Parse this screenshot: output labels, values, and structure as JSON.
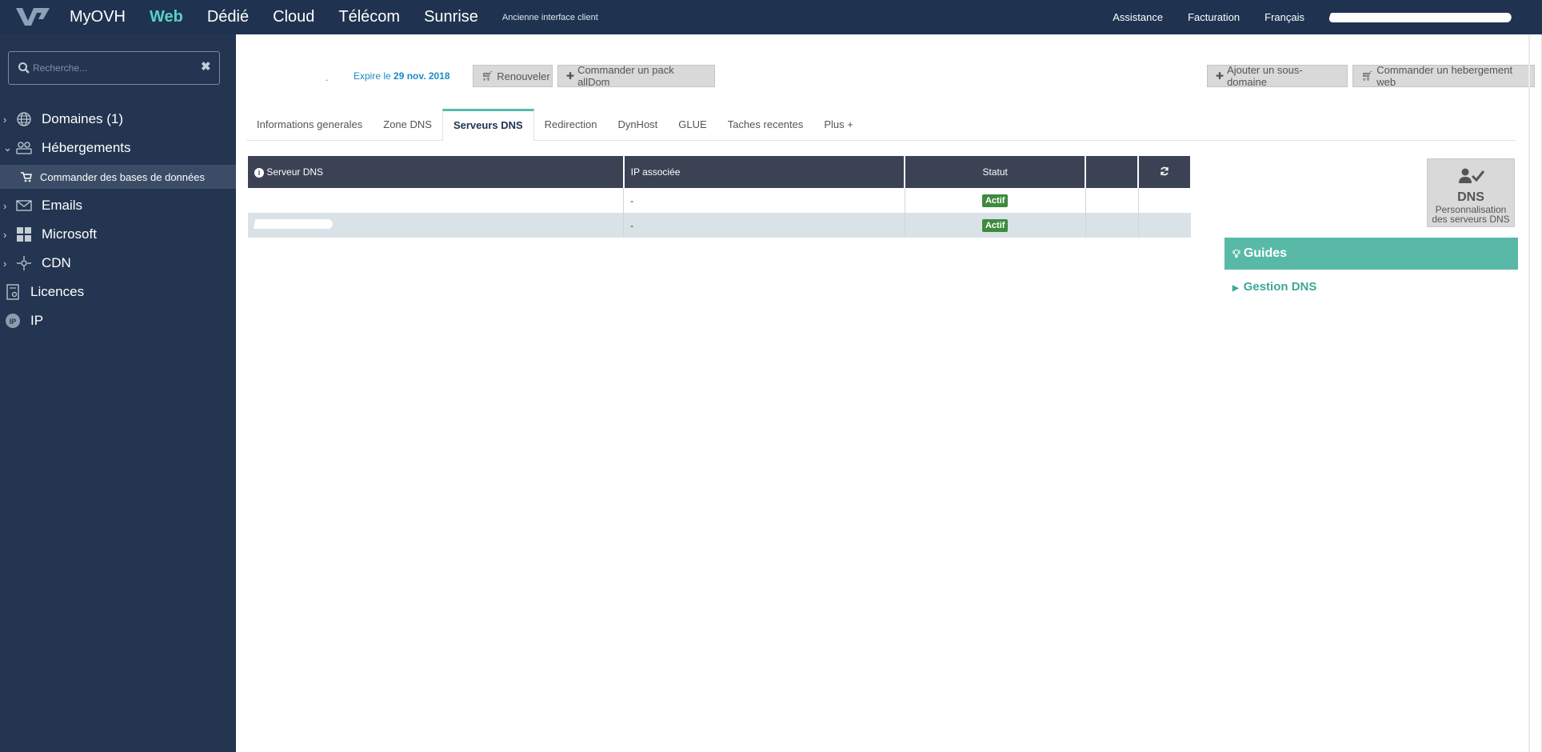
{
  "topbar": {
    "nav": [
      "MyOVH",
      "Web",
      "Dédié",
      "Cloud",
      "Télécom",
      "Sunrise"
    ],
    "active_index": 1,
    "old_interface": "Ancienne interface client",
    "right": [
      "Assistance",
      "Facturation",
      "Français"
    ]
  },
  "sidebar": {
    "search_placeholder": "Recherche...",
    "items": [
      {
        "label": "Domaines (1)",
        "icon": "globe-icon"
      },
      {
        "label": "Hébergements",
        "icon": "hosting-icon"
      },
      {
        "label": "Emails",
        "icon": "envelope-icon"
      },
      {
        "label": "Microsoft",
        "icon": "windows-icon"
      },
      {
        "label": "CDN",
        "icon": "cdn-icon"
      },
      {
        "label": "Licences",
        "icon": "license-icon"
      },
      {
        "label": "IP",
        "icon": "ip-icon"
      }
    ],
    "subitem": "Commander des bases de données"
  },
  "header": {
    "dot": ".",
    "expire_prefix": "Expire le",
    "expire_date": "29 nov. 2018",
    "renew": "Renouveler",
    "order_pack": "Commander un pack allDom",
    "add_subdomain": "Ajouter un sous-domaine",
    "order_hosting": "Commander un hebergement web"
  },
  "tabs": [
    "Informations generales",
    "Zone DNS",
    "Serveurs DNS",
    "Redirection",
    "DynHost",
    "GLUE",
    "Taches recentes",
    "Plus +"
  ],
  "active_tab": 2,
  "table": {
    "headers": [
      "Serveur DNS",
      "IP associée",
      "Statut"
    ],
    "rows": [
      {
        "ip": "-",
        "status": "Actif"
      },
      {
        "ip": "-",
        "status": "Actif"
      }
    ]
  },
  "card": {
    "title": "DNS",
    "caption1": "Personnalisation",
    "caption2": "des serveurs DNS"
  },
  "guides": {
    "title": "Guides",
    "link": "Gestion DNS"
  },
  "colors": {
    "topbar": "#1f3350",
    "sidebar": "#233550",
    "accent": "#59d2c5",
    "guides": "#59b9a7",
    "status_active": "#3f8a3f"
  }
}
